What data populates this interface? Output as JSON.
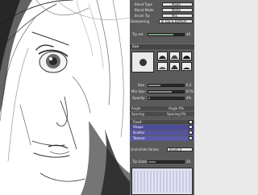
{
  "settings": {
    "blend_type_label": "Blend Type",
    "blend_type_value": "Mode",
    "blend_mode_label": "Blend Mode",
    "blend_mode_value": "Mode",
    "brush_tip_label": "Brush Tip",
    "brush_tip_value": "Mix",
    "dampen_label": "Dampening",
    "dampen_value": "To Top & Bottom",
    "tip_set_label": "Tip set",
    "tip_set_value": 40
  },
  "brush": {
    "section_label": "Size",
    "size_label": "Size",
    "size_value": "6.3",
    "size_ratio": 0.35,
    "min_size_label": "Min Size",
    "min_size_value": "67%",
    "min_size_ratio": 0.67,
    "opacity_label": "Opacity",
    "opacity_value": "4%",
    "opacity_ratio": 0.04
  },
  "dynamics": {
    "angle_label": "Angle",
    "angle_value": "Angle 0%",
    "spacing_label": "Spacing",
    "spacing_value": "Spacing 0%",
    "items": [
      {
        "label": "Fixed"
      },
      {
        "label": "Shape"
      },
      {
        "label": "Scatter"
      },
      {
        "label": "Texture"
      }
    ]
  },
  "grain": {
    "label": "Grain/hide Stroke",
    "value": "Brush 0",
    "tip_label": "Tip Grain",
    "tip_value": "20",
    "tip_ratio": 0.2
  },
  "colors": {
    "panel_bg": "#5a5a5a",
    "selected_row": "#4b4b9e",
    "canvas": "#ffffff"
  }
}
